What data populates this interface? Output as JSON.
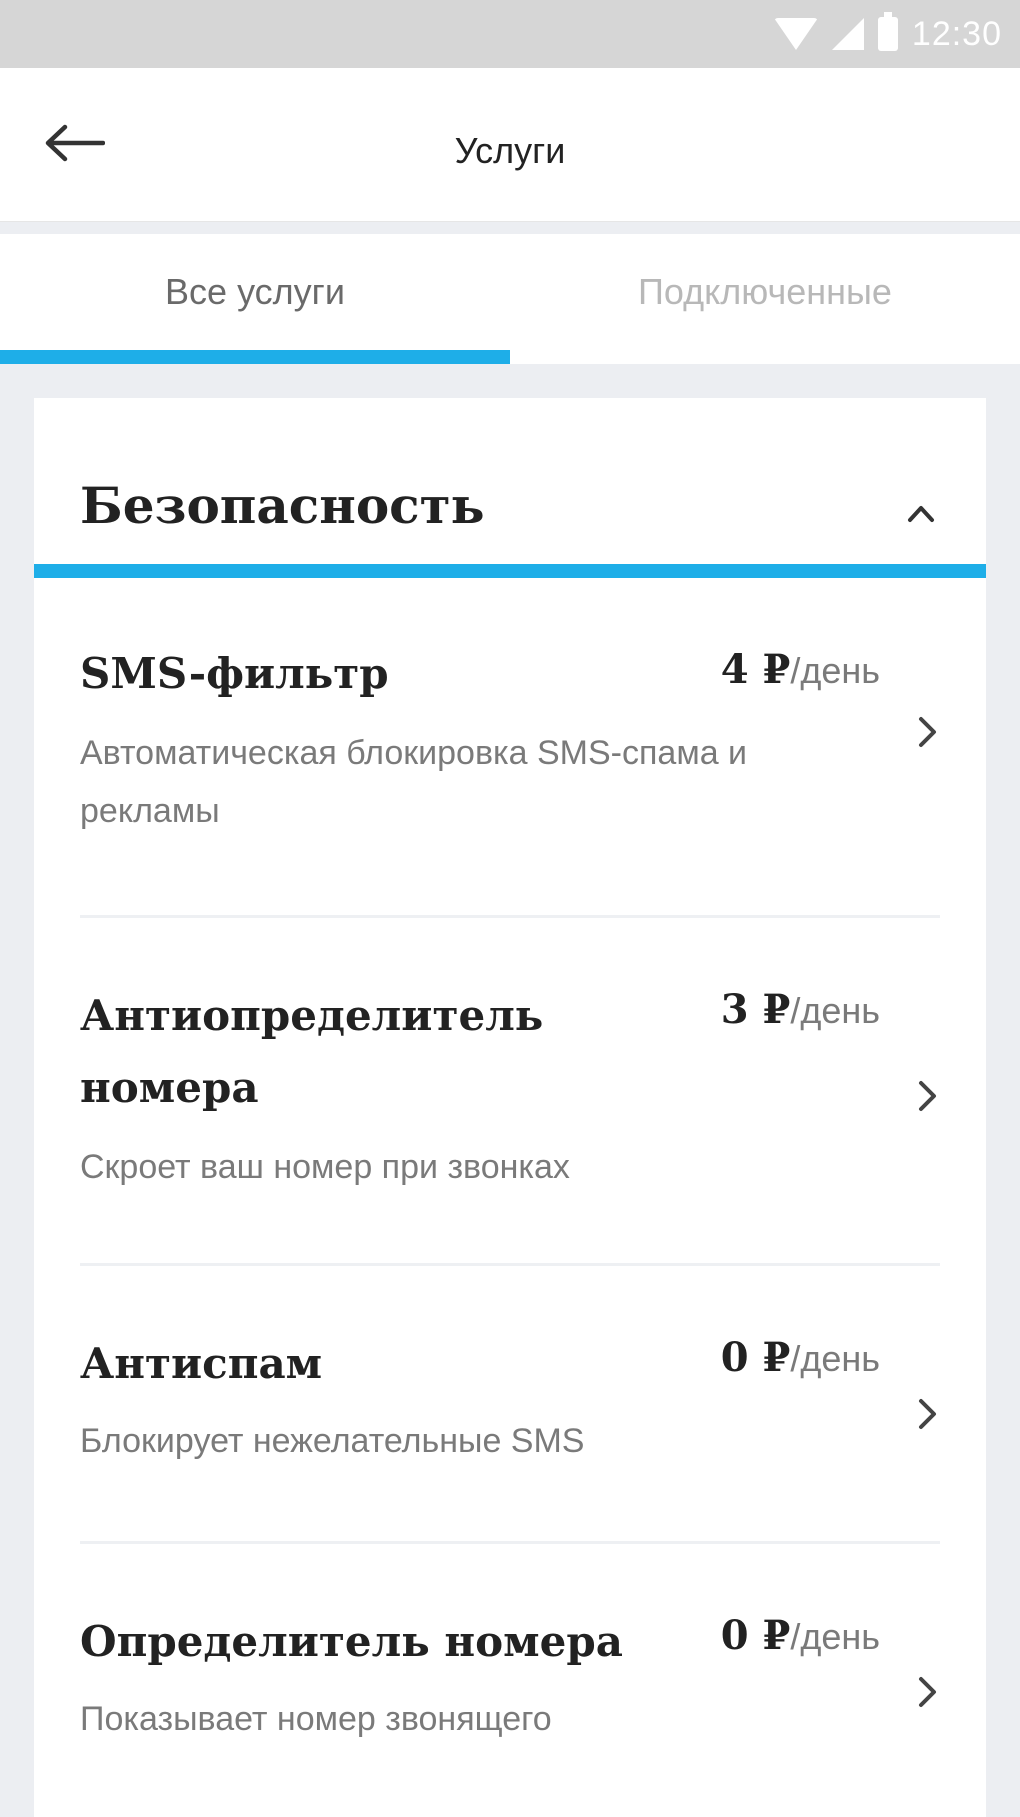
{
  "status_bar": {
    "time": "12:30",
    "icons": [
      "wifi-icon",
      "signal-icon",
      "battery-icon"
    ]
  },
  "app_bar": {
    "back_icon": "arrow-left-icon",
    "title": "Услуги"
  },
  "tabs": [
    {
      "label": "Все услуги",
      "active": true
    },
    {
      "label": "Подключенные",
      "active": false
    }
  ],
  "section": {
    "title": "Безопасность",
    "expanded": true,
    "toggle_icon": "chevron-up-icon"
  },
  "services": [
    {
      "name": "SMS-фильтр",
      "price": "4 ₽",
      "unit": "/день",
      "description": "Автоматическая блокировка SMS-спама и рекламы"
    },
    {
      "name": "Антиопределитель номера",
      "price": "3 ₽",
      "unit": "/день",
      "description": "Скроет ваш номер при звонках"
    },
    {
      "name": "Антиспам",
      "price": "0 ₽",
      "unit": "/день",
      "description": "Блокирует нежелательные SMS"
    },
    {
      "name": "Определитель номера",
      "price": "0 ₽",
      "unit": "/день",
      "description": "Показывает номер звонящего"
    }
  ],
  "colors": {
    "accent": "#1eaee8",
    "background": "#eceef2",
    "status_bar": "#d6d6d6"
  }
}
